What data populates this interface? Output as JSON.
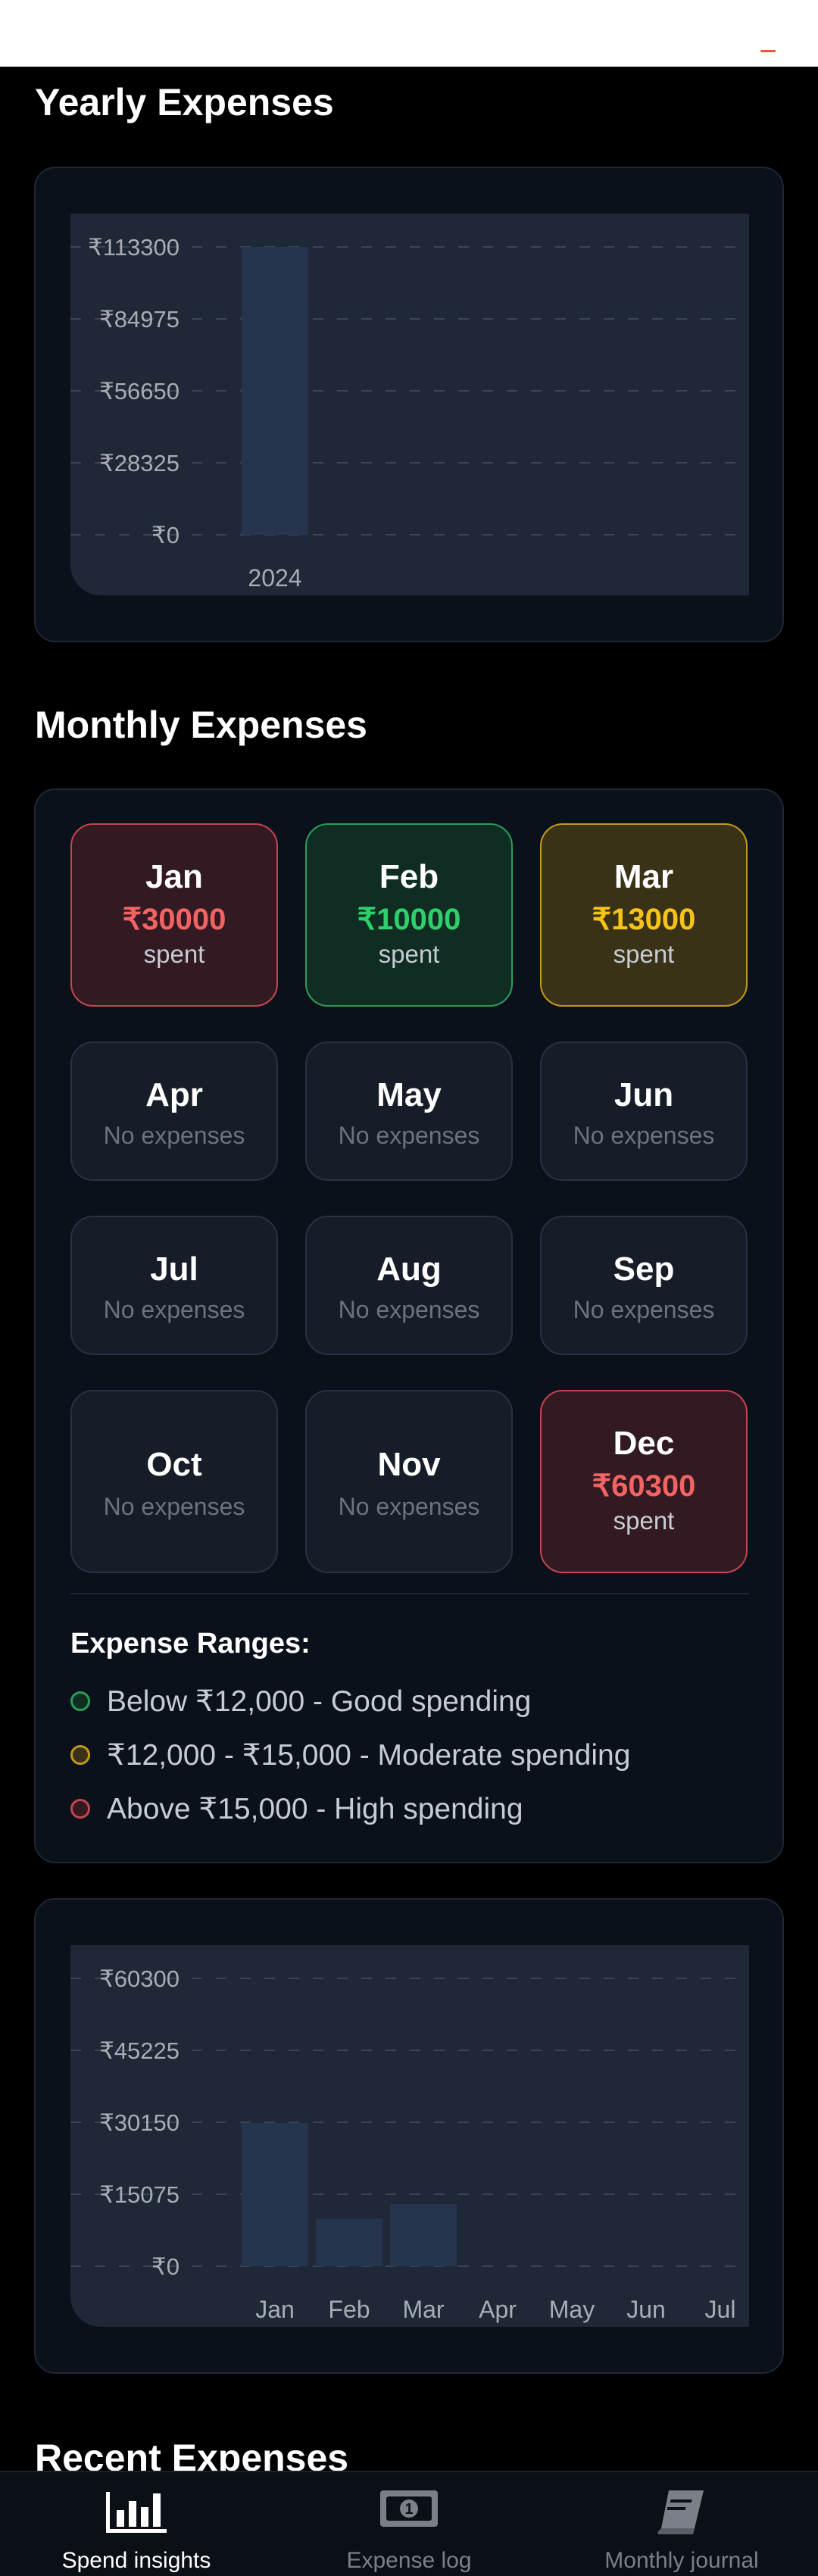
{
  "yearly": {
    "title": "Yearly Expenses",
    "chart_data": {
      "type": "bar",
      "categories": [
        "2024"
      ],
      "values": [
        113300
      ],
      "ylim": [
        0,
        113300
      ],
      "yticks": [
        "₹113300",
        "₹84975",
        "₹56650",
        "₹28325",
        "₹0"
      ],
      "grid": true
    }
  },
  "monthly": {
    "title": "Monthly Expenses",
    "months": [
      {
        "name": "Jan",
        "amount": "₹30000",
        "sub": "spent",
        "status": "red"
      },
      {
        "name": "Feb",
        "amount": "₹10000",
        "sub": "spent",
        "status": "green"
      },
      {
        "name": "Mar",
        "amount": "₹13000",
        "sub": "spent",
        "status": "yellow"
      },
      {
        "name": "Apr",
        "empty": "No expenses"
      },
      {
        "name": "May",
        "empty": "No expenses"
      },
      {
        "name": "Jun",
        "empty": "No expenses"
      },
      {
        "name": "Jul",
        "empty": "No expenses"
      },
      {
        "name": "Aug",
        "empty": "No expenses"
      },
      {
        "name": "Sep",
        "empty": "No expenses"
      },
      {
        "name": "Oct",
        "empty": "No expenses"
      },
      {
        "name": "Nov",
        "empty": "No expenses"
      },
      {
        "name": "Dec",
        "amount": "₹60300",
        "sub": "spent",
        "status": "red"
      }
    ],
    "legend": {
      "title": "Expense Ranges:",
      "items": [
        {
          "text": "Below ₹12,000 - Good spending",
          "color": "#2a9d58"
        },
        {
          "text": "₹12,000 - ₹15,000 - Moderate spending",
          "color": "#c39a1d"
        },
        {
          "text": "Above ₹15,000 - High spending",
          "color": "#c2464f"
        }
      ]
    },
    "chart_data": {
      "type": "bar",
      "categories": [
        "Jan",
        "Feb",
        "Mar",
        "Apr",
        "May",
        "Jun",
        "Jul"
      ],
      "values": [
        30000,
        10000,
        13000,
        0,
        0,
        0,
        0
      ],
      "ylim": [
        0,
        60300
      ],
      "yticks": [
        "₹60300",
        "₹45225",
        "₹30150",
        "₹15075",
        "₹0"
      ],
      "grid": true
    }
  },
  "recent": {
    "title": "Recent Expenses"
  },
  "nav": {
    "items": [
      {
        "label": "Spend insights",
        "icon": "bar-chart-icon",
        "active": true
      },
      {
        "label": "Expense log",
        "icon": "banknote-icon",
        "active": false
      },
      {
        "label": "Monthly journal",
        "icon": "book-icon",
        "active": false
      }
    ]
  },
  "colors": {
    "accent": "#e25d2b",
    "bar": "#27344d",
    "panel": "#1f2837",
    "card": "#0b111b"
  }
}
